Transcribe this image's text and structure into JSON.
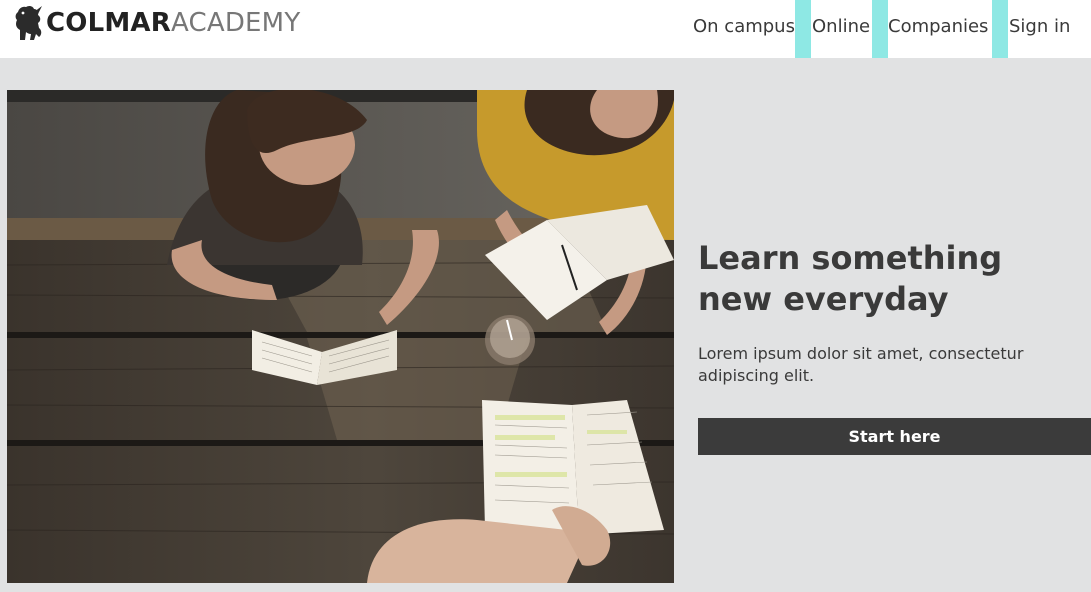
{
  "brand": {
    "logo_icon": "griffin-icon",
    "name_bold": "COLMAR",
    "name_light": "ACADEMY"
  },
  "nav": {
    "items": [
      {
        "label": "On campus"
      },
      {
        "label": "Online"
      },
      {
        "label": "Companies"
      },
      {
        "label": "Sign in"
      }
    ],
    "accent_color": "#8ee8e4"
  },
  "hero": {
    "title": "Learn something new everyday",
    "text": "Lorem ipsum dolor sit amet, consectetur adipiscing elit.",
    "cta_label": "Start here",
    "cta_color": "#3b3b3b"
  }
}
